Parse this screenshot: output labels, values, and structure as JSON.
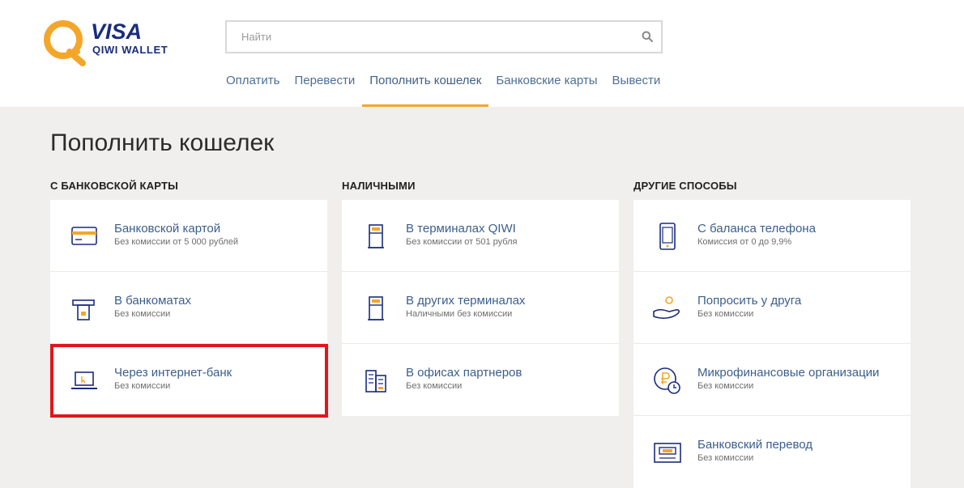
{
  "brand": {
    "visa": "VISA",
    "wallet": "QIWI WALLET"
  },
  "search": {
    "placeholder": "Найти"
  },
  "nav": [
    {
      "label": "Оплатить"
    },
    {
      "label": "Перевести"
    },
    {
      "label": "Пополнить кошелек",
      "active": true
    },
    {
      "label": "Банковские карты"
    },
    {
      "label": "Вывести"
    }
  ],
  "page_title": "Пополнить кошелек",
  "columns": [
    {
      "title": "С БАНКОВСКОЙ КАРТЫ",
      "items": [
        {
          "title": "Банковской картой",
          "subtitle": "Без комиссии от 5 000 рублей",
          "icon": "bank-card-icon"
        },
        {
          "title": "В банкоматах",
          "subtitle": "Без комиссии",
          "icon": "atm-icon"
        },
        {
          "title": "Через интернет-банк",
          "subtitle": "Без комиссии",
          "icon": "laptop-icon",
          "highlighted": true
        }
      ]
    },
    {
      "title": "НАЛИЧНЫМИ",
      "items": [
        {
          "title": "В терминалах QIWI",
          "subtitle": "Без комиссии от 501 рубля",
          "icon": "terminal-icon"
        },
        {
          "title": "В других терминалах",
          "subtitle": "Наличными без комиссии",
          "icon": "terminal-icon"
        },
        {
          "title": "В офисах партнеров",
          "subtitle": "Без комиссии",
          "icon": "office-icon"
        }
      ]
    },
    {
      "title": "ДРУГИЕ СПОСОБЫ",
      "items": [
        {
          "title": "С баланса телефона",
          "subtitle": "Комиссия от 0 до 9,9%",
          "icon": "phone-icon"
        },
        {
          "title": "Попросить у друга",
          "subtitle": "Без комиссии",
          "icon": "hand-coin-icon"
        },
        {
          "title": "Микрофинансовые организации",
          "subtitle": "Без комиссии",
          "icon": "ruble-clock-icon"
        },
        {
          "title": "Банковский перевод",
          "subtitle": "Без комиссии",
          "icon": "bank-transfer-icon"
        }
      ]
    }
  ],
  "colors": {
    "accent": "#f4a62a",
    "link": "#3a5f8d",
    "icon": "#1a2c7d",
    "highlight": "#e0161b"
  }
}
